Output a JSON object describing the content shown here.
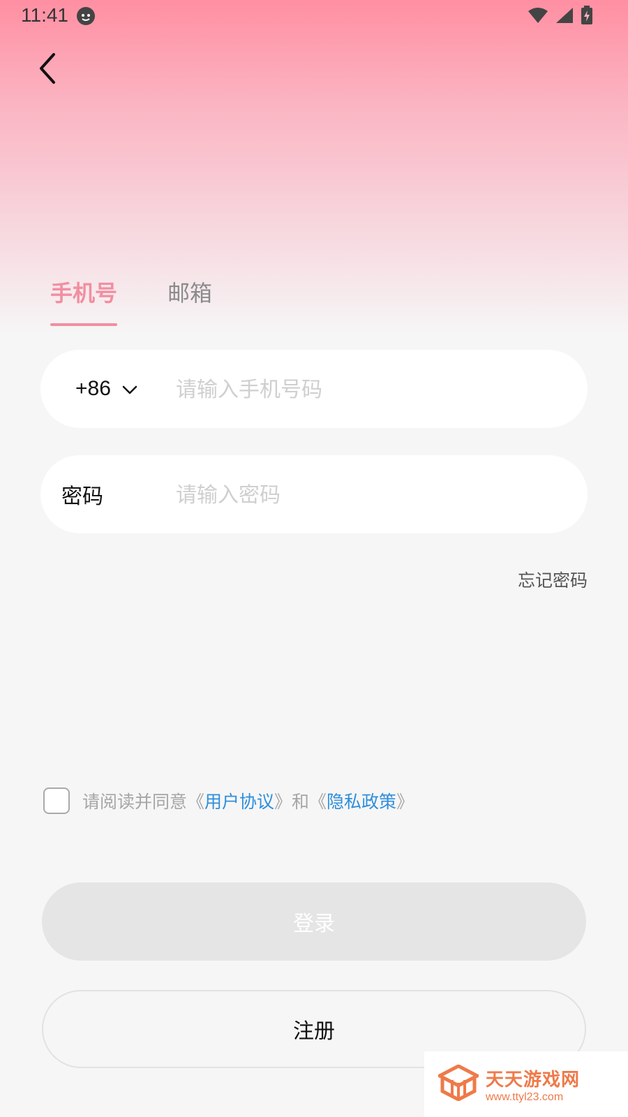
{
  "status_bar": {
    "time": "11:41"
  },
  "tabs": [
    {
      "label": "手机号",
      "active": true
    },
    {
      "label": "邮箱",
      "active": false
    }
  ],
  "phone_field": {
    "country_code": "+86",
    "placeholder": "请输入手机号码",
    "value": ""
  },
  "password_field": {
    "label": "密码",
    "placeholder": "请输入密码",
    "value": ""
  },
  "forgot_password": "忘记密码",
  "agreement": {
    "checked": false,
    "prefix": "请阅读并同意《",
    "user_agreement": "用户协议",
    "middle": "》和《",
    "privacy_policy": "隐私政策",
    "suffix": "》"
  },
  "buttons": {
    "login": "登录",
    "register": "注册"
  },
  "watermark": {
    "title": "天天游戏网",
    "url": "www.ttyl23.com"
  },
  "colors": {
    "accent": "#f28ea1",
    "link": "#2f8fdc",
    "watermark": "#ef7a49"
  },
  "icons": {
    "back": "chevron-left-icon",
    "dropdown": "chevron-down-icon",
    "wifi": "wifi-icon",
    "signal": "signal-icon",
    "battery": "battery-icon"
  }
}
